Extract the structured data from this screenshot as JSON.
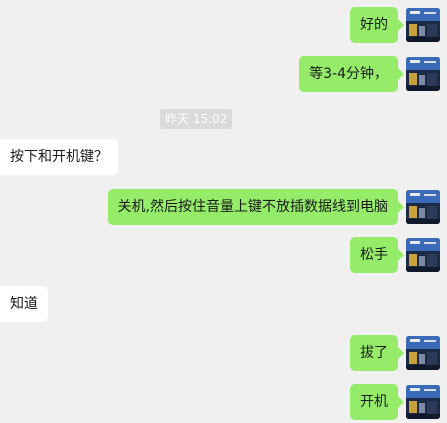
{
  "chat": {
    "timestamp": "昨天 15:02",
    "messages": [
      {
        "text": "好的",
        "side": "right"
      },
      {
        "text": "等3-4分钟，",
        "side": "right"
      },
      {
        "text": "按下和开机键？",
        "side": "left"
      },
      {
        "text": "关机,然后按住音量上键不放插数据线到电脑",
        "side": "right"
      },
      {
        "text": "松手",
        "side": "right"
      },
      {
        "text": "知道",
        "side": "left"
      },
      {
        "text": "拔了",
        "side": "right"
      },
      {
        "text": "开机",
        "side": "right"
      }
    ]
  },
  "colors": {
    "background": "#f0f0f0",
    "sent_bubble": "#95ec69",
    "received_bubble": "#ffffff",
    "timestamp_bg": "#dadada"
  },
  "avatar_icon": "user-avatar-icon"
}
